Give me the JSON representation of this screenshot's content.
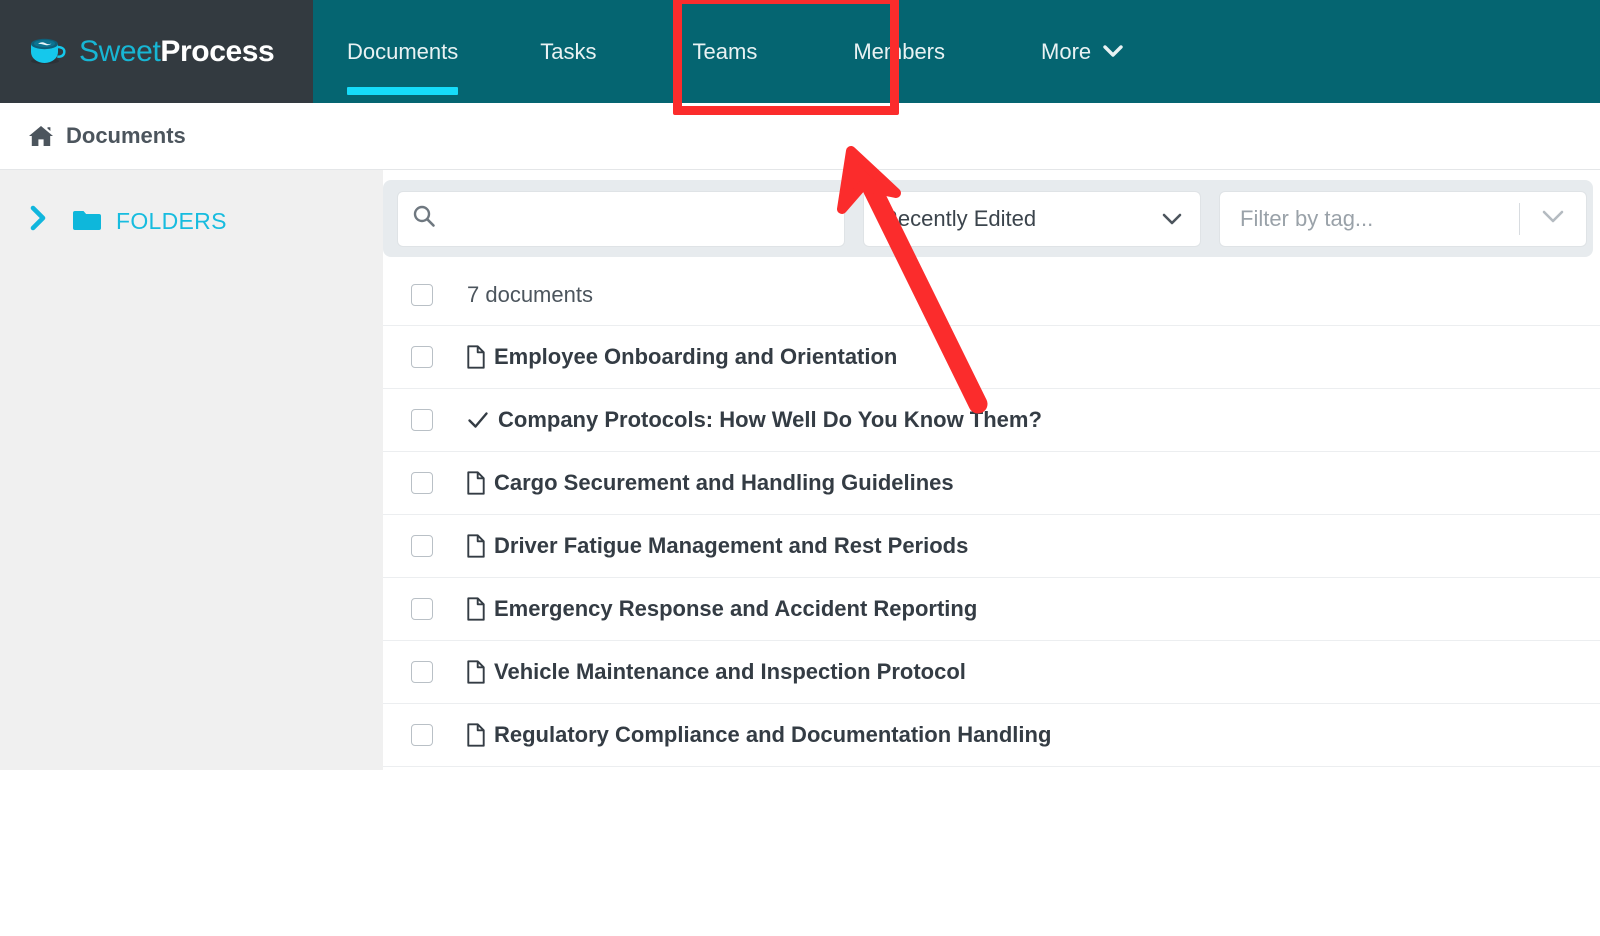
{
  "brand": {
    "name_part1": "Sweet",
    "name_part2": "Process",
    "logo_icon": "coffee-cup-icon"
  },
  "nav": {
    "items": [
      {
        "label": "Documents",
        "active": true
      },
      {
        "label": "Tasks",
        "active": false
      },
      {
        "label": "Teams",
        "active": false,
        "highlighted": true
      },
      {
        "label": "Members",
        "active": false
      },
      {
        "label": "More",
        "active": false,
        "caret": "⌄",
        "has_dropdown": true
      }
    ],
    "bg_color": "#056571",
    "brand_bg_color": "#333a40",
    "active_underline_color": "#16dcfa"
  },
  "breadcrumb": {
    "icon": "home-icon",
    "label": "Documents"
  },
  "sidebar": {
    "folders": {
      "chevron": "❯",
      "icon": "folder-icon",
      "label": "FOLDERS",
      "color": "#17bcdf"
    }
  },
  "toolbar": {
    "search": {
      "icon": "search-icon",
      "placeholder": "",
      "value": ""
    },
    "sort_select": {
      "value": "Recently Edited",
      "chevron": "⌄"
    },
    "tag_filter": {
      "placeholder": "Filter by tag...",
      "chevron": "⌄"
    }
  },
  "documents": {
    "count_label": "7 documents",
    "select_all_checkbox": false,
    "rows": [
      {
        "title": "Employee Onboarding and Orientation",
        "icon": "document-page-icon",
        "checked": false
      },
      {
        "title": "Company Protocols: How Well Do You Know Them?",
        "icon": "checkmark-icon",
        "checked": false
      },
      {
        "title": "Cargo Securement and Handling Guidelines",
        "icon": "document-page-icon",
        "checked": false
      },
      {
        "title": "Driver Fatigue Management and Rest Periods",
        "icon": "document-page-icon",
        "checked": false
      },
      {
        "title": "Emergency Response and Accident Reporting",
        "icon": "document-page-icon",
        "checked": false
      },
      {
        "title": "Vehicle Maintenance and Inspection Protocol",
        "icon": "document-page-icon",
        "checked": false
      },
      {
        "title": "Regulatory Compliance and Documentation Handling",
        "icon": "document-page-icon",
        "checked": false
      }
    ]
  },
  "annotations": {
    "highlight_color": "#fb2c2c",
    "rectangle_target": "Teams",
    "arrow_points_to": "Teams"
  }
}
